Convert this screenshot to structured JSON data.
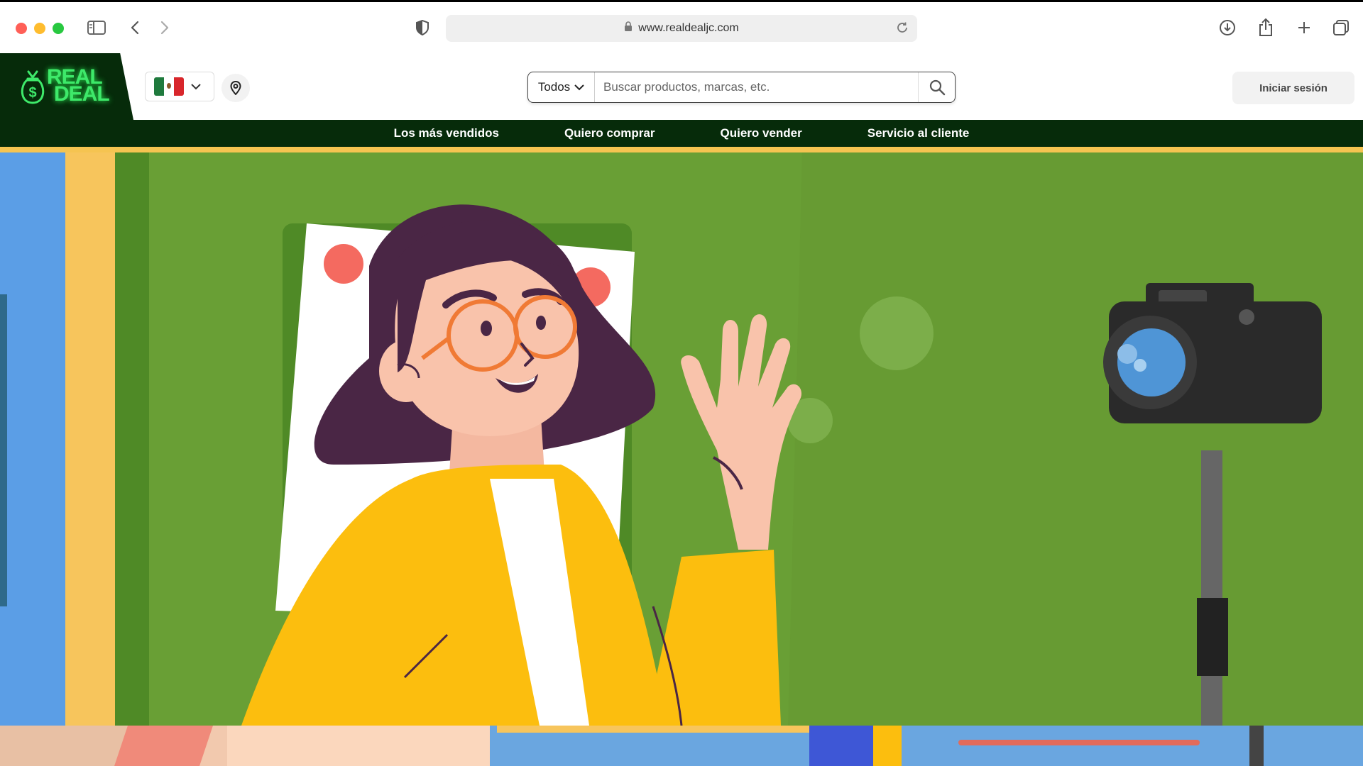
{
  "browser": {
    "url": "www.realdealjc.com"
  },
  "header": {
    "logo_line1": "REAL",
    "logo_line2": "DEAL",
    "country_flag": "mexico-flag",
    "search": {
      "category": "Todos",
      "placeholder": "Buscar productos, marcas, etc."
    },
    "login_label": "Iniciar sesión"
  },
  "nav": {
    "items": [
      {
        "label": "Los más vendidos"
      },
      {
        "label": "Quiero comprar"
      },
      {
        "label": "Quiero vender"
      },
      {
        "label": "Servicio al cliente"
      }
    ]
  },
  "colors": {
    "brand_dark": "#062b0a",
    "brand_neon": "#3ee96a",
    "hero_green": "#679b33",
    "accent_yellow": "#f5c451"
  }
}
